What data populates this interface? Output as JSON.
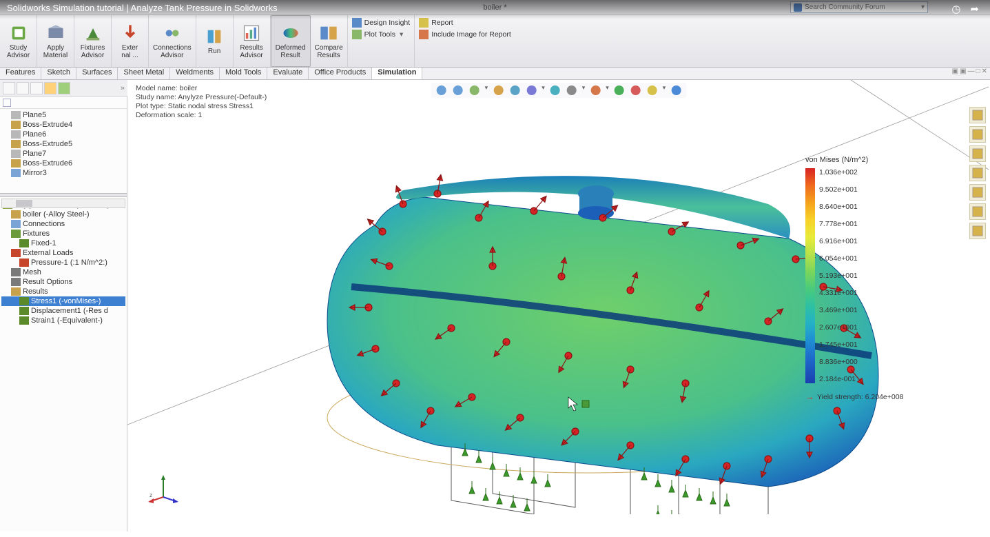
{
  "overlay": {
    "title": "Solidworks Simulation tutorial | Analyze Tank Pressure in Solidworks"
  },
  "titlebar": {
    "doc": "boiler *",
    "search_placeholder": "Search Community Forum"
  },
  "ribbon": {
    "study_advisor": "Study\nAdvisor",
    "apply_material": "Apply\nMaterial",
    "fixtures_advisor": "Fixtures\nAdvisor",
    "external": "Exter\nnal ...",
    "connections_advisor": "Connections\nAdvisor",
    "run": "Run",
    "results_advisor": "Results\nAdvisor",
    "deformed_result": "Deformed\nResult",
    "compare_results": "Compare\nResults",
    "design_insight": "Design Insight",
    "plot_tools": "Plot Tools",
    "report": "Report",
    "include_image": "Include Image for Report"
  },
  "ftabs": {
    "items": [
      "Features",
      "Sketch",
      "Surfaces",
      "Sheet Metal",
      "Weldments",
      "Mold Tools",
      "Evaluate",
      "Office Products",
      "Simulation"
    ],
    "active_index": 8
  },
  "vp_info": {
    "l1": "Model name: boiler",
    "l2": "Study name: Anylyze Pressure(-Default-)",
    "l3": "Plot type: Static nodal stress Stress1",
    "l4": "Deformation scale: 1"
  },
  "tree_top": [
    {
      "label": "Plane5",
      "ic": "#b8b8b8"
    },
    {
      "label": "Boss-Extrude4",
      "ic": "#c7a24a"
    },
    {
      "label": "Plane6",
      "ic": "#b8b8b8"
    },
    {
      "label": "Boss-Extrude5",
      "ic": "#c7a24a"
    },
    {
      "label": "Plane7",
      "ic": "#b8b8b8"
    },
    {
      "label": "Boss-Extrude6",
      "ic": "#c7a24a"
    },
    {
      "label": "Mirror3",
      "ic": "#7aa3d6"
    }
  ],
  "tree_sim": [
    {
      "label": "Anylyze Pressure (-Default-)",
      "ic": "#8aa84a",
      "indent": 0
    },
    {
      "label": "boiler (-Alloy Steel-)",
      "ic": "#c7a24a",
      "indent": 1
    },
    {
      "label": "Connections",
      "ic": "#7aa3d6",
      "indent": 1
    },
    {
      "label": "Fixtures",
      "ic": "#6a9a3a",
      "indent": 1
    },
    {
      "label": "Fixed-1",
      "ic": "#5a8a2a",
      "indent": 2
    },
    {
      "label": "External Loads",
      "ic": "#c7452a",
      "indent": 1
    },
    {
      "label": "Pressure-1 (:1 N/m^2:)",
      "ic": "#c7452a",
      "indent": 2
    },
    {
      "label": "Mesh",
      "ic": "#7a7a7a",
      "indent": 1
    },
    {
      "label": "Result Options",
      "ic": "#7a7a7a",
      "indent": 1
    },
    {
      "label": "Results",
      "ic": "#c7a24a",
      "indent": 1
    },
    {
      "label": "Stress1 (-vonMises-)",
      "ic": "#5a8a2a",
      "indent": 2,
      "sel": true
    },
    {
      "label": "Displacement1 (-Res d",
      "ic": "#5a8a2a",
      "indent": 2
    },
    {
      "label": "Strain1 (-Equivalent-)",
      "ic": "#5a8a2a",
      "indent": 2
    }
  ],
  "legend": {
    "title": "von Mises (N/m^2)",
    "ticks": [
      "1.036e+002",
      "9.502e+001",
      "8.640e+001",
      "7.778e+001",
      "6.916e+001",
      "6.054e+001",
      "5.193e+001",
      "4.331e+001",
      "3.469e+001",
      "2.607e+001",
      "1.745e+001",
      "8.836e+000",
      "2.184e-001"
    ],
    "yield": "Yield strength: 6.204e+008"
  },
  "viewport_toolbar_colors": [
    "#6aa0d8",
    "#6aa0d8",
    "#8ab86a",
    "#d6a24a",
    "#5aa3c7",
    "#7a7ad6",
    "#4ab0c0",
    "#8a8a8a",
    "#d6774a",
    "#4ab05a",
    "#d65a5a",
    "#d6c24a",
    "#4a8ad6"
  ],
  "rtools_colors": [
    "#d6b24a",
    "#d6b24a",
    "#d6b24a",
    "#d6b24a",
    "#d6b24a",
    "#d6b24a",
    "#d6b24a"
  ]
}
